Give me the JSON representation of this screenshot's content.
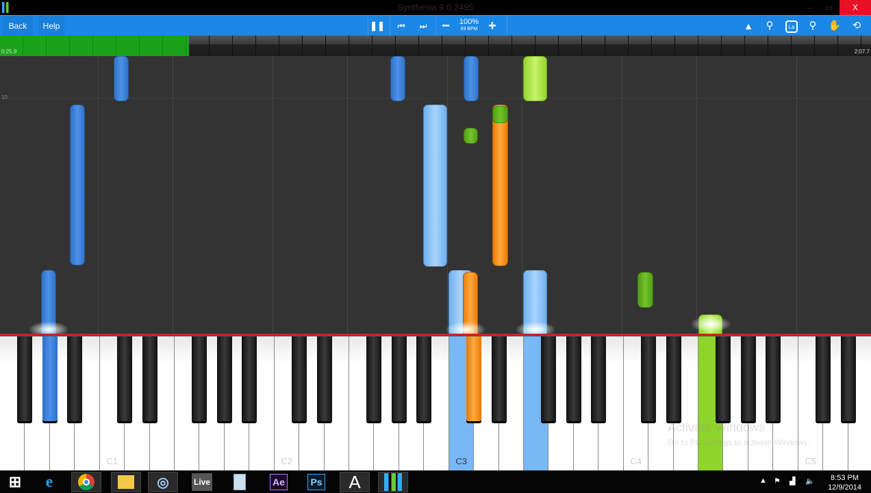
{
  "window": {
    "title": "Synthesia 9.0.2495",
    "close": "X",
    "minimize": "–",
    "restore": "▭"
  },
  "toolbar": {
    "back": "Back",
    "help": "Help",
    "pause": "❚❚",
    "prev": "⏮",
    "next": "⏭",
    "minus": "−",
    "speed_percent": "100%",
    "bpm": "69 BPM",
    "plus": "+",
    "icons": [
      "metronome-icon",
      "search-icon",
      "la-icon",
      "location-pin-icon",
      "hand-icon",
      "loop-icon"
    ],
    "la_label": "La"
  },
  "progress": {
    "elapsed": "0:25.9",
    "total": "2:07.7",
    "fraction": 0.203,
    "color": "#1aa31a"
  },
  "roll": {
    "measure_label": "10"
  },
  "keyboard": {
    "labels": [
      "C1",
      "C2",
      "C3",
      "C4",
      "C5"
    ]
  },
  "colors": {
    "left_hand": "#4b92e6",
    "right_hand": "#72c42a",
    "left_hand_light": "#a9d4fb",
    "orange": "#ffa93a"
  },
  "watermark": {
    "line1": "Activate Windows",
    "line2": "Go to PC settings to activate Windows."
  },
  "taskbar": {
    "apps": [
      "Start",
      "Internet Explorer",
      "Chrome",
      "File Explorer",
      "Ableton",
      "Live",
      "Calculator",
      "Ae",
      "Ps",
      "A",
      "Synthesia"
    ],
    "time": "8:53 PM",
    "date": "12/9/2014"
  }
}
